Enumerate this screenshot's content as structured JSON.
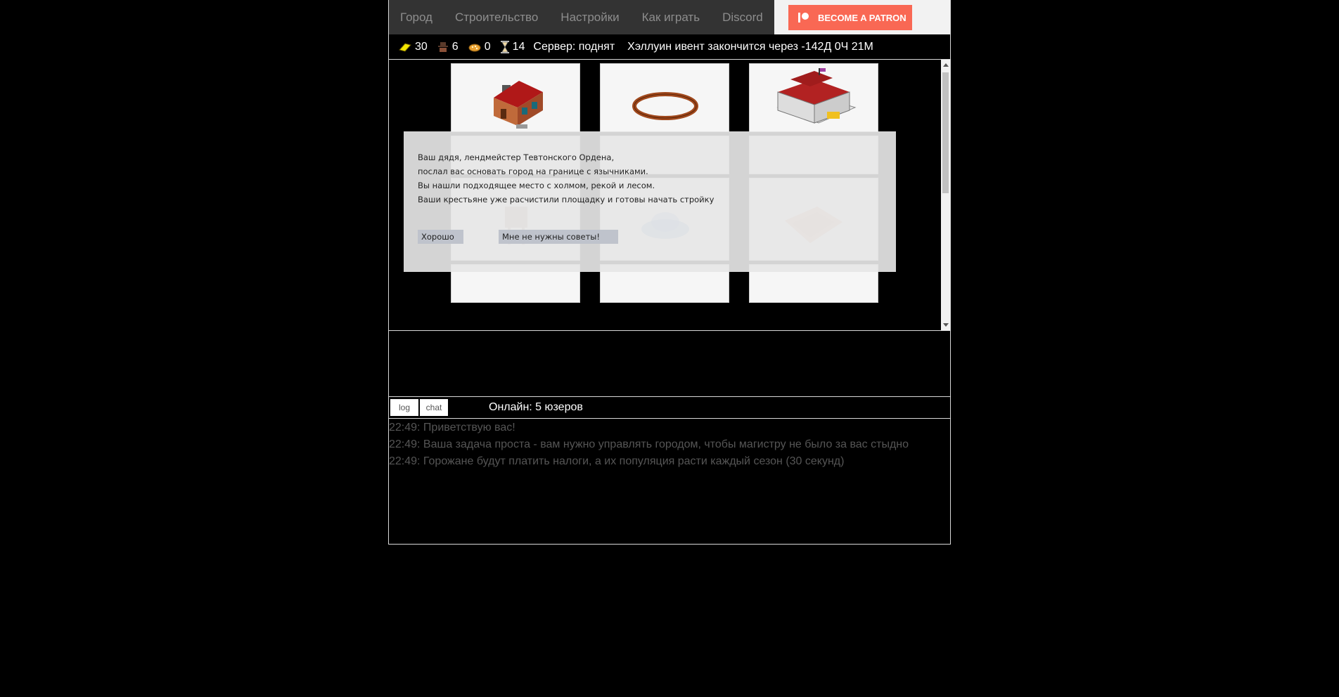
{
  "nav": {
    "items": [
      "Город",
      "Строительство",
      "Настройки",
      "Как играть",
      "Discord"
    ],
    "patron_label": "BECOME A PATRON",
    "patron_color": "#f96854"
  },
  "resources": {
    "gold": "30",
    "people": "6",
    "food": "0",
    "time": "14",
    "server_status": "Сервер: поднят",
    "event_text": "Хэллуин ивент закончится через -142Д 0Ч 21М"
  },
  "modal": {
    "lines": [
      "Ваш дядя, лендмейстер Тевтонского Ордена,",
      "послал вас основать город на границе с язычниками.",
      "Вы нашли подходящее место с холмом, рекой и лесом.",
      "Ваши крестьяне уже расчистили площадку и готовы начать стройку"
    ],
    "ok_label": "Хорошо",
    "no_tips_label": "Мне не нужны советы!"
  },
  "tabs": {
    "log_label": "log",
    "chat_label": "chat",
    "online_text": "Онлайн: 5 юзеров"
  },
  "log": {
    "lines": [
      "22:49: Приветствую вас!",
      "22:49: Ваша задача проста - вам нужно управлять городом, чтобы магистру не было за вас стыдно",
      "22:49: Горожане будут платить налоги, а их популяция расти каждый сезон (30 секунд)"
    ]
  }
}
